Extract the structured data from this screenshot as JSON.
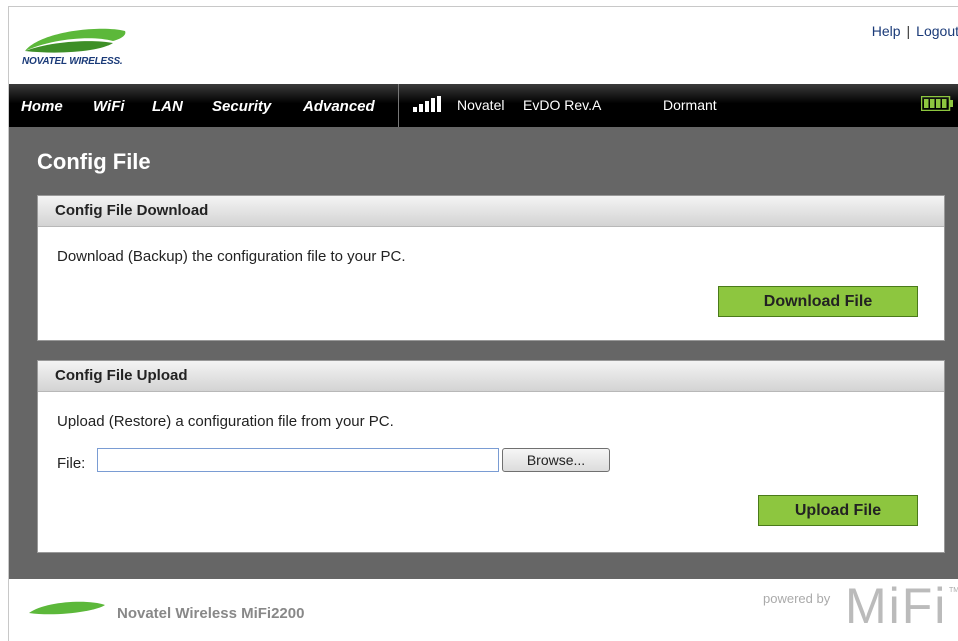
{
  "brand": {
    "logo_text": "NOVATEL WIRELESS."
  },
  "top_links": {
    "help": "Help",
    "separator": "|",
    "logout": "Logout"
  },
  "nav": {
    "items": [
      "Home",
      "WiFi",
      "LAN",
      "Security",
      "Advanced"
    ],
    "carrier": "Novatel",
    "network_type": "EvDO Rev.A",
    "connection_state": "Dormant",
    "signal_icon": "signal-bars-icon",
    "battery_icon": "battery-icon"
  },
  "page": {
    "title": "Config File"
  },
  "download_panel": {
    "heading": "Config File Download",
    "description": "Download (Backup) the configuration file to your PC.",
    "button_label": "Download File"
  },
  "upload_panel": {
    "heading": "Config File Upload",
    "description": "Upload (Restore) a configuration file from your PC.",
    "file_label": "File:",
    "file_value": "",
    "browse_label": "Browse...",
    "button_label": "Upload File"
  },
  "footer": {
    "product": "Novatel Wireless MiFi2200",
    "powered_by": "powered by",
    "mifi_logo": "MiFi",
    "trademark": "TM"
  },
  "colors": {
    "accent_green": "#8dc63f",
    "nav_bg": "#000000",
    "content_bg": "#666666",
    "brand_blue": "#1a3a78"
  }
}
